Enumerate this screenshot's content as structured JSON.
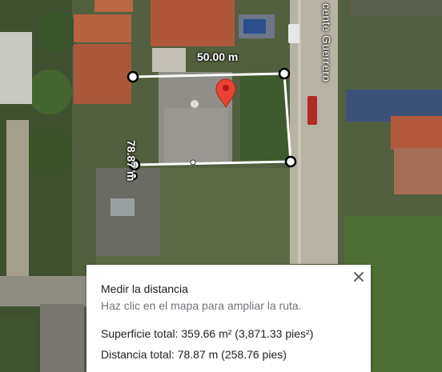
{
  "map": {
    "street_name": "cente Guerrero",
    "measurement": {
      "top_edge_label": "50.00 m",
      "left_edge_label": "78.87 m"
    },
    "colors": {
      "measure_line": "#ffffff",
      "vertex_fill": "#ffffff",
      "vertex_stroke": "#000000",
      "pin": "#ea4335"
    },
    "icons": [
      "location-pin-icon",
      "close-icon"
    ]
  },
  "panel": {
    "title": "Medir la distancia",
    "hint": "Haz clic en el mapa para ampliar la ruta.",
    "area": "Superficie total: 359.66 m² (3,871.33 pies²)",
    "distance": "Distancia total: 78.87 m (258.76 pies)"
  }
}
